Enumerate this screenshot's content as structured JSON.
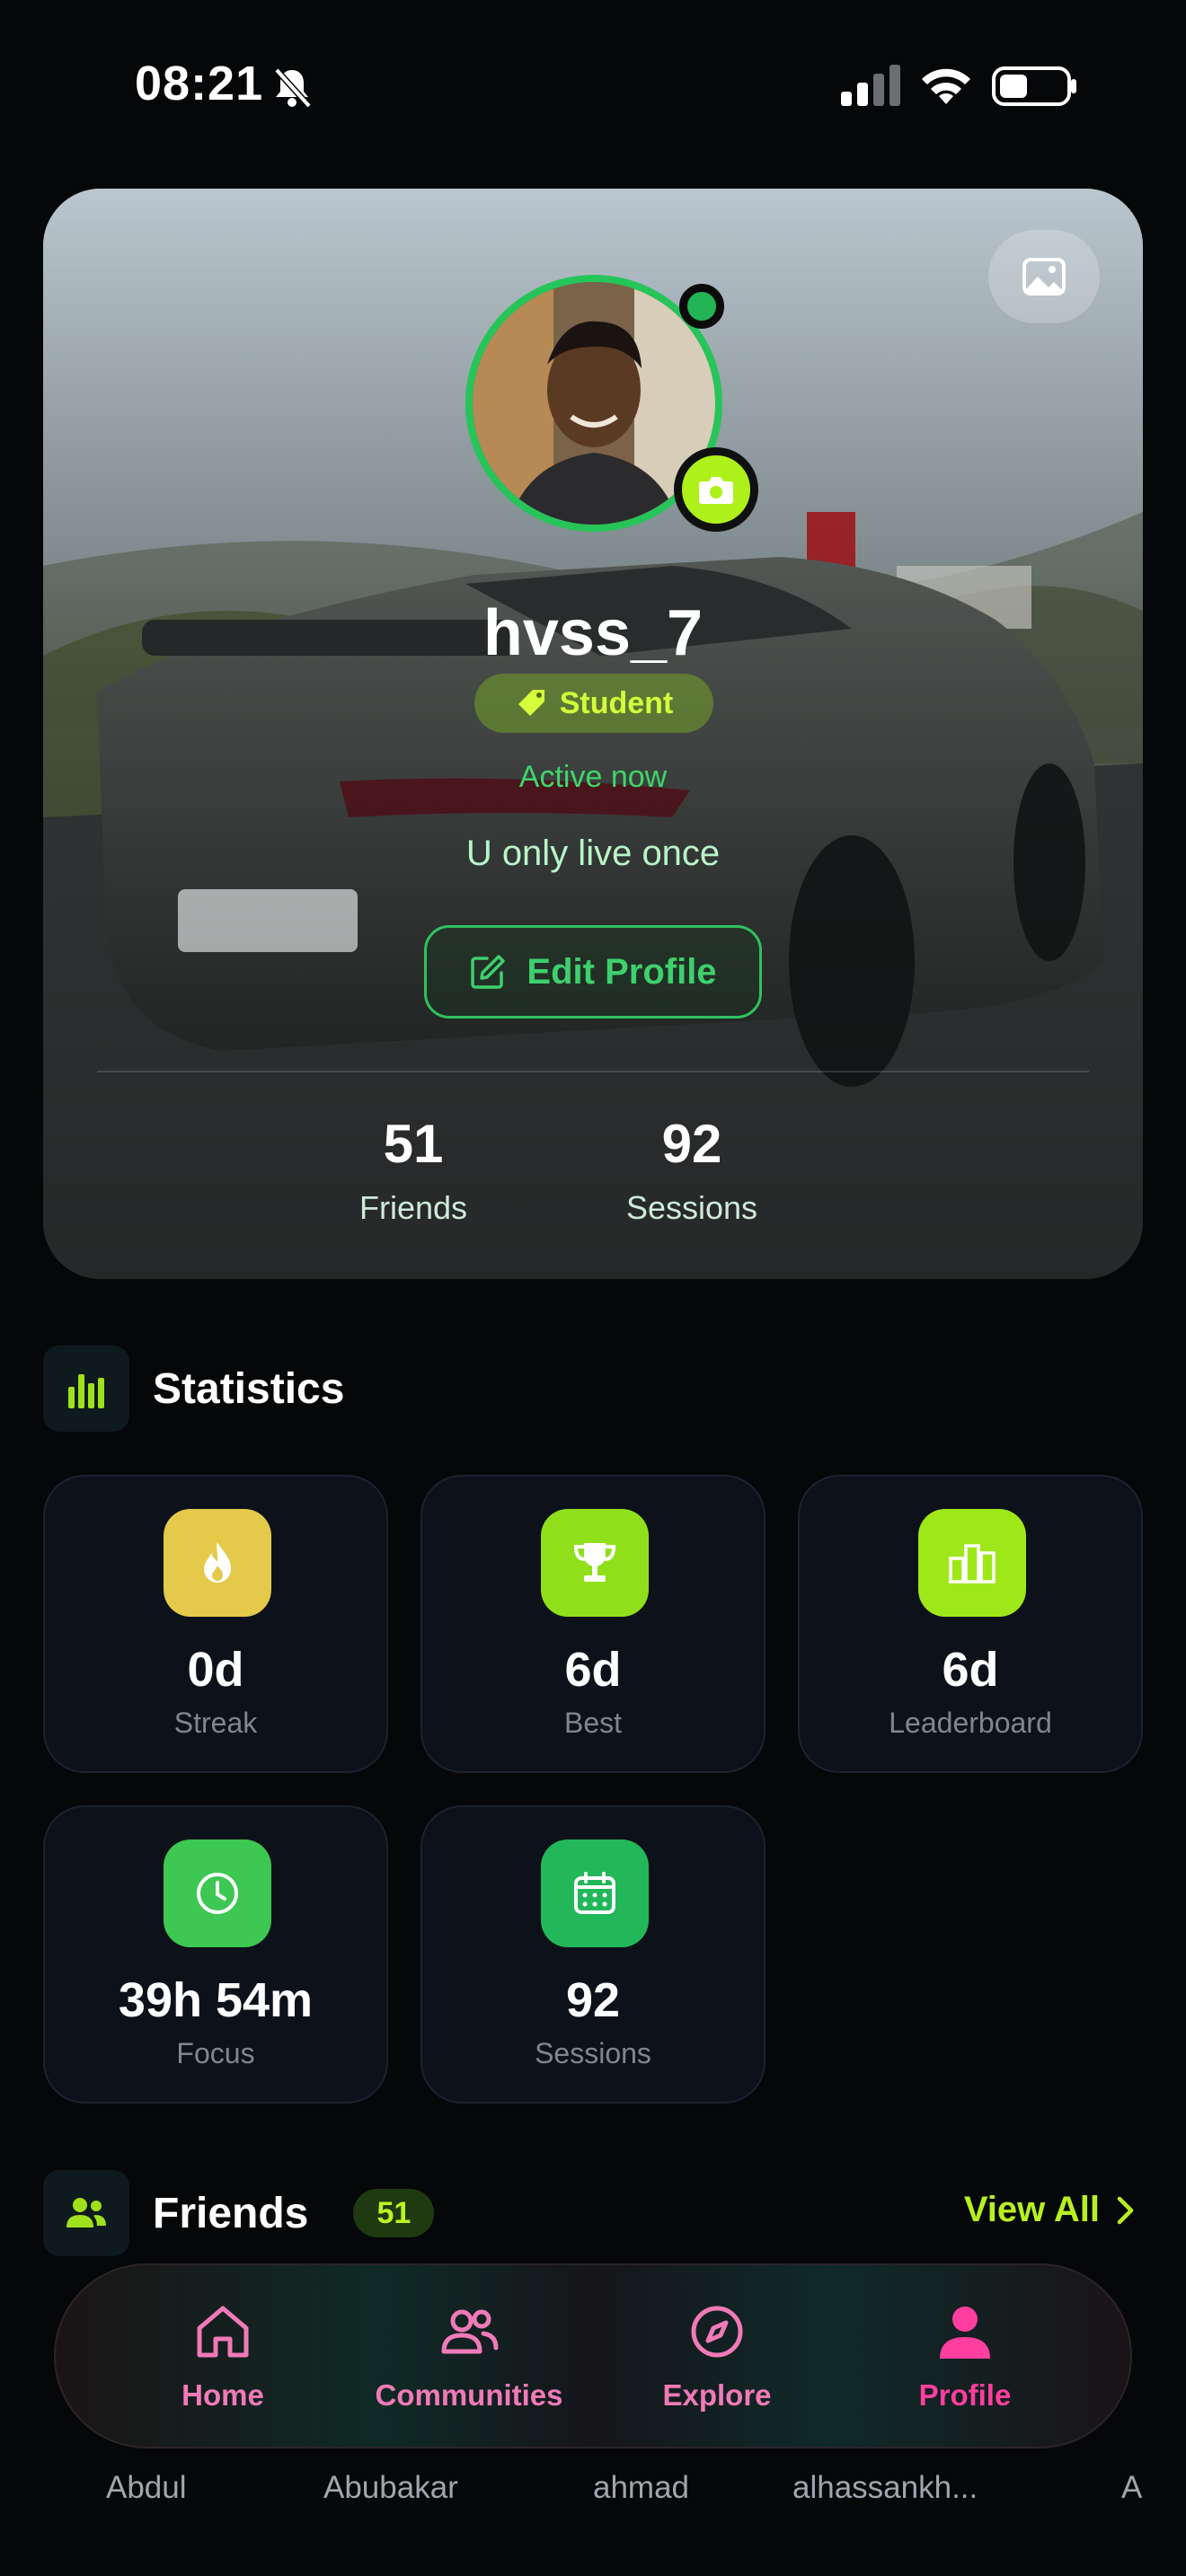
{
  "status_bar": {
    "time": "08:21"
  },
  "profile": {
    "username": "hvss_7",
    "role": "Student",
    "presence": "Active now",
    "bio": "U only live once",
    "edit_label": "Edit Profile",
    "stats": [
      {
        "value": "51",
        "label": "Friends"
      },
      {
        "value": "92",
        "label": "Sessions"
      }
    ]
  },
  "statistics": {
    "title": "Statistics",
    "cards": [
      {
        "value": "0d",
        "label": "Streak",
        "icon": "flame-icon",
        "color": "#e5c94a"
      },
      {
        "value": "6d",
        "label": "Best",
        "icon": "trophy-icon",
        "color": "#8fe01a"
      },
      {
        "value": "6d",
        "label": "Leaderboard",
        "icon": "leaderboard-icon",
        "color": "#9ee81a"
      },
      {
        "value": "39h 54m",
        "label": "Focus",
        "icon": "clock-icon",
        "color": "#3cc852"
      },
      {
        "value": "92",
        "label": "Sessions",
        "icon": "calendar-icon",
        "color": "#22b85a"
      }
    ]
  },
  "friends": {
    "title": "Friends",
    "count": "51",
    "view_all": "View All",
    "names": [
      "Abdul",
      "Abubakar",
      "ahmad",
      "alhassankh...",
      "A"
    ]
  },
  "nav": {
    "items": [
      {
        "label": "Home",
        "icon": "home-icon"
      },
      {
        "label": "Communities",
        "icon": "people-icon"
      },
      {
        "label": "Explore",
        "icon": "compass-icon"
      },
      {
        "label": "Profile",
        "icon": "person-icon"
      }
    ],
    "active": "Profile",
    "colors": {
      "inactive": "#f07ab8",
      "active": "#ff3ea0"
    }
  }
}
